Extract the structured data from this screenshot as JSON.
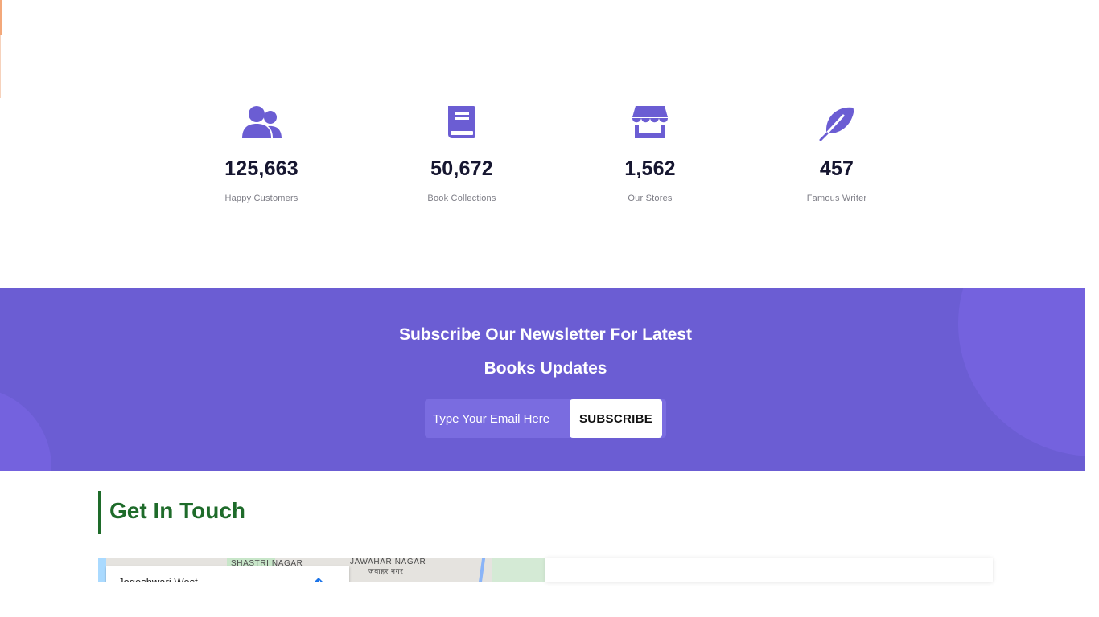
{
  "stats": [
    {
      "icon": "users-icon",
      "value": "125,663",
      "label": "Happy Customers"
    },
    {
      "icon": "book-icon",
      "value": "50,672",
      "label": "Book Collections"
    },
    {
      "icon": "store-icon",
      "value": "1,562",
      "label": "Our Stores"
    },
    {
      "icon": "feather-icon",
      "value": "457",
      "label": "Famous Writer"
    }
  ],
  "newsletter": {
    "title_line1": "Subscribe Our Newsletter For Latest",
    "title_line2": "Books Updates",
    "email_placeholder": "Type Your Email Here",
    "button_label": "SUBSCRIBE"
  },
  "contact": {
    "title": "Get In Touch"
  },
  "map": {
    "labels": [
      "SHASTRI NAGAR",
      "JAWAHAR NAGAR",
      "जवाहर नगर"
    ],
    "place_title": "Jogeshwari West"
  },
  "colors": {
    "accent": "#6b5dd3",
    "icon": "#6b5dd3",
    "heading_green": "#1e6b2a",
    "stat_number": "#161630"
  }
}
